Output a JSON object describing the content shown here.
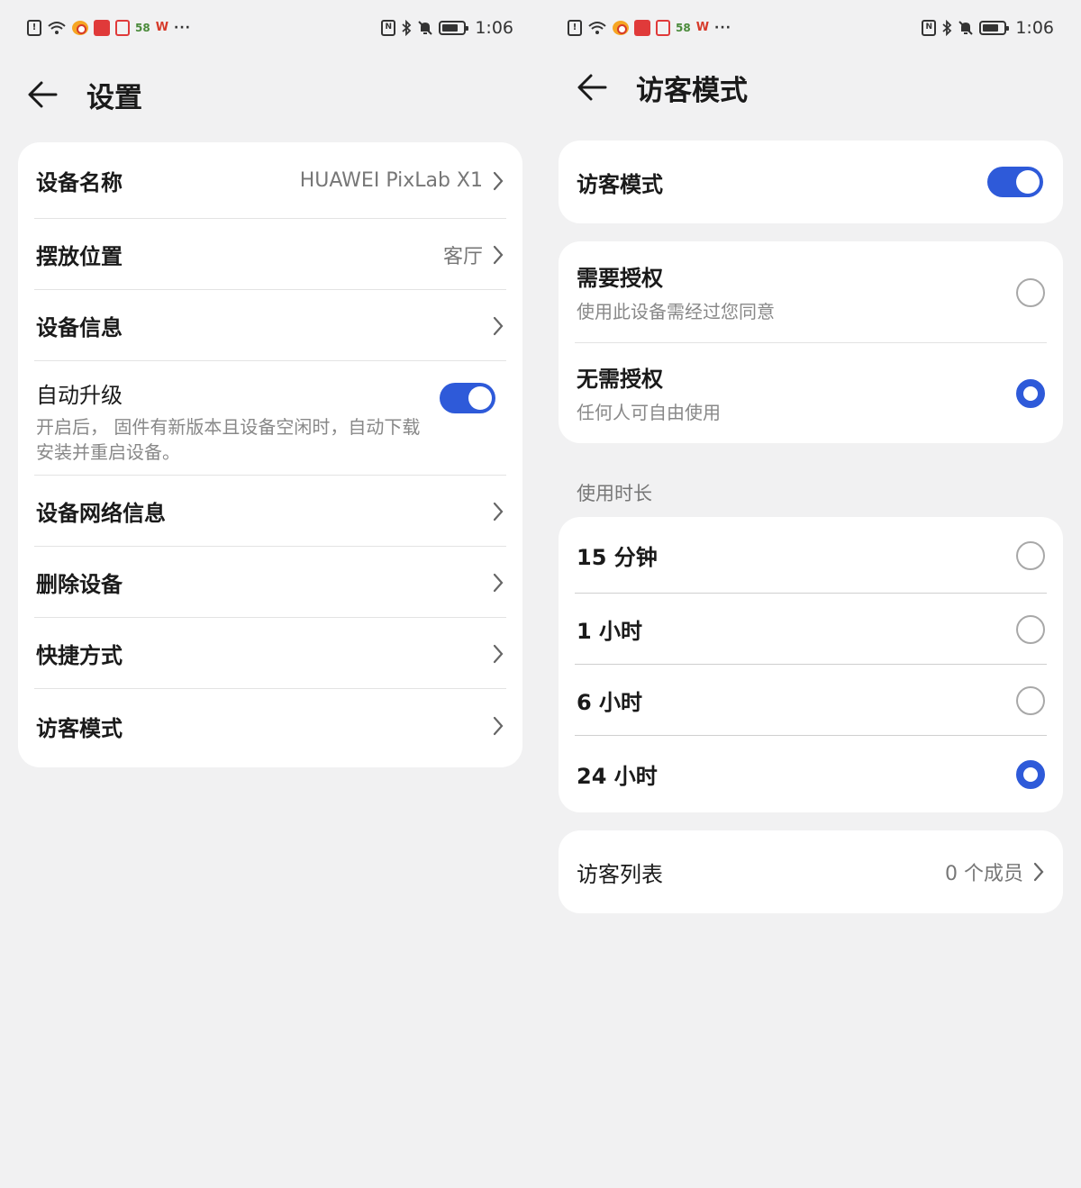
{
  "status_bar": {
    "time": "1:06",
    "app_badges": [
      "58",
      "W",
      "···"
    ],
    "icons": [
      "alert-icon",
      "wifi-icon",
      "weibo-icon",
      "news-icon",
      "app-icon",
      "nfc-icon",
      "bluetooth-icon",
      "mute-icon",
      "battery-icon"
    ]
  },
  "settings": {
    "title": "设置",
    "items": [
      {
        "label": "设备名称",
        "value": "HUAWEI PixLab X1"
      },
      {
        "label": "摆放位置",
        "value": "客厅"
      },
      {
        "label": "设备信息"
      },
      {
        "label": "自动升级",
        "sub": "开启后， 固件有新版本且设备空闲时，自动下载安装并重启设备。",
        "toggle": true
      },
      {
        "label": "设备网络信息"
      },
      {
        "label": "删除设备"
      },
      {
        "label": "快捷方式"
      },
      {
        "label": "访客模式"
      }
    ]
  },
  "guest": {
    "title": "访客模式",
    "mode_label": "访客模式",
    "mode_enabled": true,
    "auth_options": [
      {
        "label": "需要授权",
        "sub": "使用此设备需经过您同意",
        "selected": false
      },
      {
        "label": "无需授权",
        "sub": "任何人可自由使用",
        "selected": true
      }
    ],
    "duration_title": "使用时长",
    "durations": [
      {
        "label": "15 分钟",
        "selected": false
      },
      {
        "label": "1 小时",
        "selected": false
      },
      {
        "label": "6 小时",
        "selected": false
      },
      {
        "label": "24 小时",
        "selected": true
      }
    ],
    "visitor_list_label": "访客列表",
    "visitor_list_value": "0 个成员"
  },
  "colors": {
    "accent": "#2e5ad9",
    "background": "#f1f1f2",
    "card": "#ffffff"
  }
}
